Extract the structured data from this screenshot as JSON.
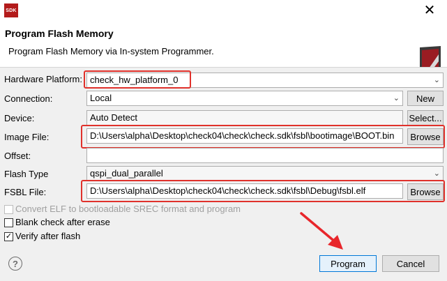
{
  "window": {
    "logo_text": "SDK",
    "close_glyph": "✕"
  },
  "header": {
    "title": "Program Flash Memory",
    "subtitle": "Program Flash Memory via In-system Programmer."
  },
  "form": {
    "hardware_platform": {
      "label": "Hardware Platform:",
      "value": "check_hw_platform_0"
    },
    "connection": {
      "label": "Connection:",
      "value": "Local",
      "new_button": "New"
    },
    "device": {
      "label": "Device:",
      "value": "Auto Detect",
      "select_button": "Select..."
    },
    "image_file": {
      "label": "Image File:",
      "value": "D:\\Users\\alpha\\Desktop\\check04\\check\\check.sdk\\fsbl\\bootimage\\BOOT.bin",
      "browse_button": "Browse"
    },
    "offset": {
      "label": "Offset:",
      "value": ""
    },
    "flash_type": {
      "label": "Flash Type",
      "value": "qspi_dual_parallel"
    },
    "fsbl_file": {
      "label": "FSBL File:",
      "value": "D:\\Users\\alpha\\Desktop\\check04\\check\\check.sdk\\fsbl\\Debug\\fsbl.elf",
      "browse_button": "Browse"
    }
  },
  "options": [
    {
      "label": "Convert ELF to bootloadable SREC format and program",
      "checked": false,
      "enabled": false
    },
    {
      "label": "Blank check after erase",
      "checked": false,
      "enabled": true
    },
    {
      "label": "Verify after flash",
      "checked": true,
      "enabled": true
    }
  ],
  "footer": {
    "help_glyph": "?",
    "program_button": "Program",
    "cancel_button": "Cancel"
  },
  "colors": {
    "highlight": "#e0312b",
    "arrow": "#e8262b",
    "default_button_border": "#0078d7"
  }
}
